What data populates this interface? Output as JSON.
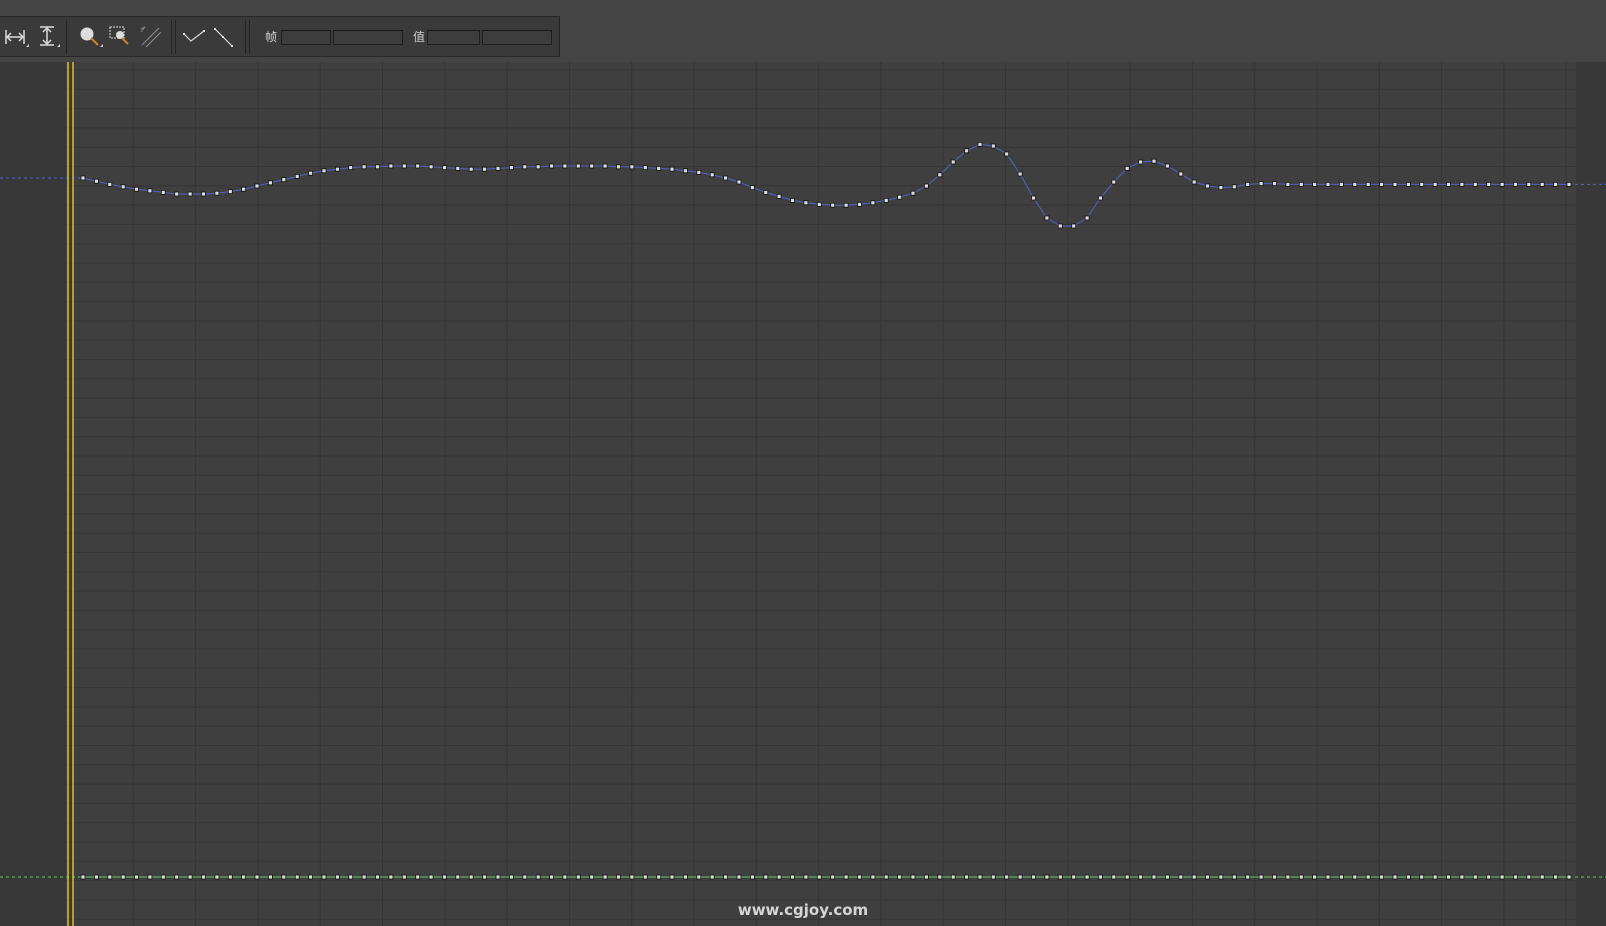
{
  "toolbar": {
    "frame_label": "帧",
    "frame_value": "",
    "value_label": "值",
    "value_value": "",
    "icons": [
      "fit-horizontal-icon",
      "fit-vertical-icon",
      "zoom-icon",
      "zoom-region-icon",
      "scale-keys-icon",
      "tangent-flat-icon",
      "tangent-linear-icon"
    ]
  },
  "watermark": "www.cgjoy.com",
  "colors": {
    "background": "#3f3f3f",
    "grid_line": "#353535",
    "left_panel": "#383838",
    "curve_primary": "#5264c8",
    "curve_secondary": "#64c864",
    "time_slider": "#d8c020",
    "key_fill": "#dddddd",
    "key_stroke": "#111111"
  },
  "curves": {
    "primary": {
      "name": "",
      "keys": [
        0.1,
        0.06,
        0.02,
        -0.01,
        -0.04,
        -0.06,
        -0.08,
        -0.1,
        -0.1,
        -0.1,
        -0.09,
        -0.07,
        -0.04,
        0.0,
        0.04,
        0.08,
        0.12,
        0.16,
        0.19,
        0.21,
        0.23,
        0.24,
        0.24,
        0.25,
        0.25,
        0.25,
        0.24,
        0.23,
        0.22,
        0.21,
        0.21,
        0.22,
        0.23,
        0.24,
        0.24,
        0.25,
        0.25,
        0.25,
        0.25,
        0.25,
        0.24,
        0.24,
        0.23,
        0.22,
        0.21,
        0.19,
        0.17,
        0.14,
        0.1,
        0.05,
        -0.02,
        -0.08,
        -0.13,
        -0.18,
        -0.21,
        -0.23,
        -0.24,
        -0.24,
        -0.23,
        -0.21,
        -0.18,
        -0.14,
        -0.09,
        0.0,
        0.14,
        0.3,
        0.44,
        0.52,
        0.5,
        0.4,
        0.15,
        -0.15,
        -0.4,
        -0.5,
        -0.5,
        -0.4,
        -0.15,
        0.05,
        0.22,
        0.3,
        0.31,
        0.25,
        0.15,
        0.05,
        0.0,
        -0.02,
        -0.01,
        0.02,
        0.03,
        0.03,
        0.02,
        0.02,
        0.02,
        0.02,
        0.02,
        0.02,
        0.02,
        0.02,
        0.02,
        0.02,
        0.02,
        0.02,
        0.02,
        0.02,
        0.02,
        0.02,
        0.02,
        0.02,
        0.02,
        0.02,
        0.02,
        0.02
      ]
    },
    "secondary": {
      "name": "",
      "keys": [
        0,
        0,
        0,
        0,
        0,
        0,
        0,
        0,
        0,
        0,
        0,
        0,
        0,
        0,
        0,
        0,
        0,
        0,
        0,
        0,
        0,
        0,
        0,
        0,
        0,
        0,
        0,
        0,
        0,
        0,
        0,
        0,
        0,
        0,
        0,
        0,
        0,
        0,
        0,
        0,
        0,
        0,
        0,
        0,
        0,
        0,
        0,
        0,
        0,
        0,
        0,
        0,
        0,
        0,
        0,
        0,
        0,
        0,
        0,
        0,
        0,
        0,
        0,
        0,
        0,
        0,
        0,
        0,
        0,
        0,
        0,
        0,
        0,
        0,
        0,
        0,
        0,
        0,
        0,
        0,
        0,
        0,
        0,
        0,
        0,
        0,
        0,
        0,
        0,
        0,
        0,
        0,
        0,
        0,
        0,
        0,
        0,
        0,
        0,
        0,
        0,
        0,
        0,
        0,
        0,
        0,
        0,
        0,
        0,
        0,
        0,
        0
      ]
    }
  }
}
